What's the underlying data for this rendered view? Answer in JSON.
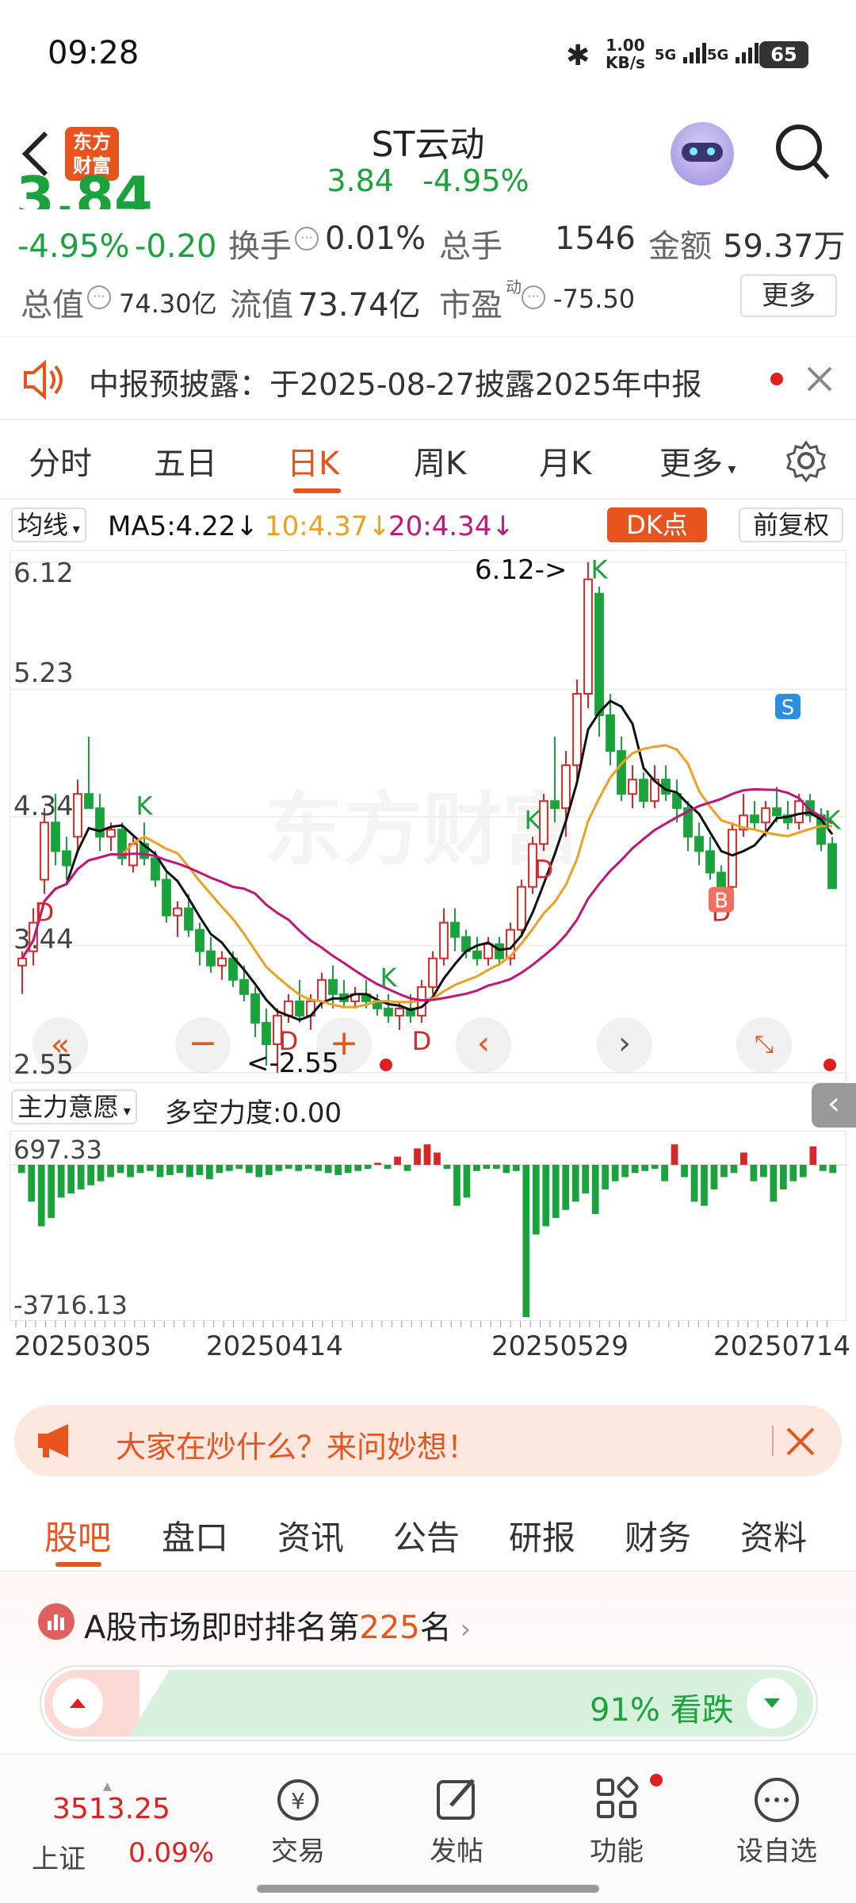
{
  "status": {
    "time": "09:28",
    "net_speed": "1.00",
    "net_unit": "KB/s",
    "sig1": "5G",
    "sig2": "5G",
    "battery": "65"
  },
  "header": {
    "logo_line1": "东方",
    "logo_line2": "财富",
    "title": "ST云动",
    "price": "3.84",
    "change_pct": "-4.95%"
  },
  "quote": {
    "big_price": "3.84",
    "pct": "-4.95%",
    "chg": "-0.20",
    "turnover_label": "换手",
    "turnover_val": "0.01%",
    "vol_label": "总手",
    "vol_val": "1546",
    "amt_label": "金额",
    "amt_val": "59.37万",
    "mktcap_label": "总值",
    "mktcap_val": "74.30亿",
    "float_label": "流值",
    "float_val": "73.74亿",
    "pe_label": "市盈",
    "pe_sup": "动",
    "pe_val": "-75.50",
    "more": "更多"
  },
  "notice": {
    "text": "中报预披露：于2025-08-27披露2025年中报"
  },
  "period_tabs": [
    "分时",
    "五日",
    "日K",
    "周K",
    "月K",
    "更多"
  ],
  "ma": {
    "selector": "均线",
    "ma5": "MA5:4.22",
    "ma10": "10:4.37",
    "ma20": "20:4.34",
    "dk": "DK点",
    "adjust": "前复权",
    "colors": {
      "ma5": "#111111",
      "ma10": "#f0a020",
      "ma20": "#c0167a"
    }
  },
  "chart_labels": {
    "high": "6.12->",
    "low": "<-2.55",
    "watermark": "东方财富"
  },
  "chart_data": {
    "type": "candlestick",
    "y_ticks": [
      "6.12",
      "5.23",
      "4.34",
      "3.44",
      "2.55"
    ],
    "ylim": [
      2.55,
      6.12
    ],
    "max_marker": 6.12,
    "min_marker": 2.55,
    "x_dates": [
      "20250305",
      "20250414",
      "20250529",
      "20250714"
    ],
    "candles": [
      [
        3.3,
        3.4,
        3.1,
        3.35
      ],
      [
        3.4,
        3.7,
        3.3,
        3.6
      ],
      [
        3.9,
        4.4,
        3.8,
        4.3
      ],
      [
        4.3,
        4.5,
        4.0,
        4.1
      ],
      [
        4.1,
        4.2,
        3.9,
        4.0
      ],
      [
        4.2,
        4.6,
        4.1,
        4.5
      ],
      [
        4.5,
        4.9,
        4.4,
        4.4
      ],
      [
        4.4,
        4.5,
        4.1,
        4.2
      ],
      [
        4.2,
        4.3,
        4.1,
        4.25
      ],
      [
        4.25,
        4.3,
        4.0,
        4.05
      ],
      [
        4.0,
        4.2,
        3.95,
        4.15
      ],
      [
        4.15,
        4.3,
        4.0,
        4.05
      ],
      [
        4.05,
        4.1,
        3.85,
        3.9
      ],
      [
        3.9,
        3.95,
        3.6,
        3.65
      ],
      [
        3.65,
        3.75,
        3.5,
        3.7
      ],
      [
        3.7,
        3.8,
        3.5,
        3.55
      ],
      [
        3.55,
        3.6,
        3.3,
        3.4
      ],
      [
        3.4,
        3.5,
        3.25,
        3.3
      ],
      [
        3.3,
        3.4,
        3.2,
        3.35
      ],
      [
        3.35,
        3.4,
        3.15,
        3.2
      ],
      [
        3.2,
        3.3,
        3.05,
        3.1
      ],
      [
        3.1,
        3.15,
        2.8,
        2.9
      ],
      [
        2.9,
        3.0,
        2.6,
        2.75
      ],
      [
        2.75,
        3.0,
        2.55,
        2.95
      ],
      [
        2.95,
        3.1,
        2.9,
        3.05
      ],
      [
        3.05,
        3.2,
        2.9,
        2.95
      ],
      [
        2.95,
        3.1,
        2.85,
        3.05
      ],
      [
        3.05,
        3.25,
        3.0,
        3.2
      ],
      [
        3.2,
        3.3,
        3.0,
        3.1
      ],
      [
        3.1,
        3.2,
        3.0,
        3.05
      ],
      [
        3.05,
        3.15,
        3.0,
        3.1
      ],
      [
        3.1,
        3.2,
        3.0,
        3.05
      ],
      [
        3.05,
        3.1,
        2.95,
        3.0
      ],
      [
        3.0,
        3.1,
        2.9,
        2.95
      ],
      [
        2.95,
        3.05,
        2.85,
        3.0
      ],
      [
        3.0,
        3.1,
        2.9,
        2.95
      ],
      [
        2.95,
        3.2,
        2.9,
        3.15
      ],
      [
        3.15,
        3.4,
        3.1,
        3.35
      ],
      [
        3.35,
        3.7,
        3.3,
        3.6
      ],
      [
        3.6,
        3.7,
        3.4,
        3.5
      ],
      [
        3.5,
        3.55,
        3.35,
        3.4
      ],
      [
        3.4,
        3.5,
        3.3,
        3.35
      ],
      [
        3.35,
        3.5,
        3.3,
        3.45
      ],
      [
        3.45,
        3.5,
        3.3,
        3.35
      ],
      [
        3.35,
        3.6,
        3.3,
        3.55
      ],
      [
        3.55,
        3.9,
        3.5,
        3.85
      ],
      [
        3.85,
        4.2,
        3.8,
        4.15
      ],
      [
        4.15,
        4.5,
        4.1,
        4.45
      ],
      [
        4.45,
        4.9,
        4.3,
        4.4
      ],
      [
        4.4,
        4.8,
        4.2,
        4.7
      ],
      [
        4.7,
        5.3,
        4.6,
        5.2
      ],
      [
        5.2,
        6.12,
        5.1,
        6.0
      ],
      [
        5.9,
        5.95,
        4.9,
        5.05
      ],
      [
        5.05,
        5.2,
        4.7,
        4.8
      ],
      [
        4.8,
        4.9,
        4.45,
        4.5
      ],
      [
        4.5,
        4.7,
        4.4,
        4.6
      ],
      [
        4.6,
        4.65,
        4.4,
        4.45
      ],
      [
        4.45,
        4.7,
        4.4,
        4.6
      ],
      [
        4.6,
        4.7,
        4.45,
        4.5
      ],
      [
        4.5,
        4.6,
        4.3,
        4.4
      ],
      [
        4.4,
        4.45,
        4.1,
        4.2
      ],
      [
        4.2,
        4.3,
        4.0,
        4.1
      ],
      [
        4.1,
        4.2,
        3.9,
        3.95
      ],
      [
        3.95,
        4.0,
        3.8,
        3.85
      ],
      [
        3.85,
        4.3,
        3.8,
        4.25
      ],
      [
        4.25,
        4.5,
        4.2,
        4.35
      ],
      [
        4.35,
        4.45,
        4.25,
        4.3
      ],
      [
        4.3,
        4.45,
        4.2,
        4.4
      ],
      [
        4.4,
        4.55,
        4.3,
        4.35
      ],
      [
        4.35,
        4.45,
        4.25,
        4.3
      ],
      [
        4.3,
        4.5,
        4.25,
        4.45
      ],
      [
        4.45,
        4.5,
        4.3,
        4.35
      ],
      [
        4.35,
        4.4,
        4.1,
        4.15
      ],
      [
        4.15,
        4.2,
        3.84,
        3.84
      ]
    ],
    "signals": [
      {
        "i": 2,
        "t": "D"
      },
      {
        "i": 11,
        "t": "K"
      },
      {
        "i": 24,
        "t": "D"
      },
      {
        "i": 33,
        "t": "K"
      },
      {
        "i": 36,
        "t": "D"
      },
      {
        "i": 46,
        "t": "K"
      },
      {
        "i": 47,
        "t": "D"
      },
      {
        "i": 52,
        "t": "K"
      },
      {
        "i": 63,
        "t": "D"
      },
      {
        "i": 73,
        "t": "K"
      }
    ],
    "bs": [
      {
        "i": 63,
        "t": "B",
        "price": 3.75
      },
      {
        "i": 69,
        "t": "S",
        "price": 5.1
      }
    ]
  },
  "indicator": {
    "selector": "主力意愿",
    "label": "多空力度:0.00",
    "top": "697.33",
    "bottom": "-3716.13"
  },
  "indicator_data": {
    "ylim": [
      -3716.13,
      697.33
    ],
    "values": [
      -200,
      -900,
      -1500,
      -1300,
      -800,
      -700,
      -600,
      -500,
      -400,
      -300,
      -200,
      -300,
      -200,
      -150,
      -300,
      -250,
      -200,
      -300,
      -250,
      -350,
      -200,
      -150,
      -100,
      -200,
      -300,
      -250,
      -150,
      -100,
      -150,
      -100,
      -150,
      -200,
      -250,
      -200,
      -150,
      -100,
      50,
      -100,
      200,
      -150,
      400,
      500,
      300,
      -100,
      -1000,
      -800,
      -150,
      -100,
      -100,
      -200,
      -150,
      -3716,
      -1700,
      -1500,
      -1300,
      -1100,
      -900,
      -700,
      -1200,
      -600,
      -400,
      -300,
      -200,
      -150,
      -100,
      -400,
      500,
      -300,
      -900,
      -1000,
      -600,
      -300,
      -200,
      300,
      -400,
      -300,
      -900,
      -600,
      -400,
      -300,
      450,
      -150,
      -200
    ]
  },
  "banner": {
    "text": "大家在炒什么？来问妙想！"
  },
  "info_tabs": [
    "股吧",
    "盘口",
    "资讯",
    "公告",
    "研报",
    "财务",
    "资料"
  ],
  "rank": {
    "prefix": "A股市场即时排名第",
    "num": "225",
    "suffix": "名",
    "pct": "91%",
    "label": "看跌"
  },
  "bottom_nav": {
    "index_val": "3513.25",
    "index_name": "上证",
    "index_pct": "0.09%",
    "items": [
      "交易",
      "发帖",
      "功能",
      "设自选"
    ]
  }
}
